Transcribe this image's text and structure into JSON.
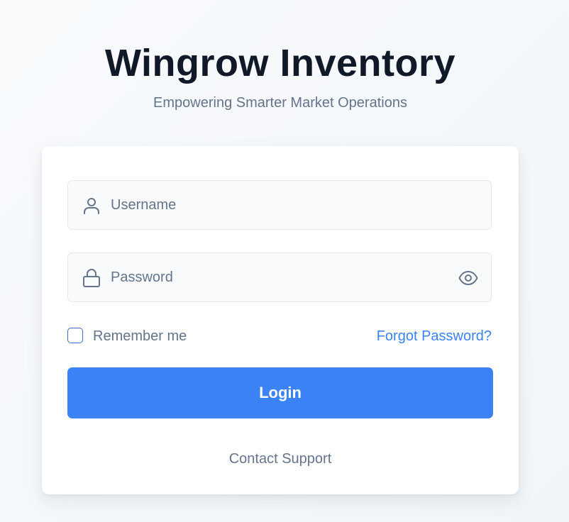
{
  "header": {
    "title": "Wingrow Inventory",
    "subtitle": "Empowering Smarter Market Operations"
  },
  "form": {
    "username": {
      "placeholder": "Username",
      "value": "",
      "icon": "user-icon"
    },
    "password": {
      "placeholder": "Password",
      "value": "",
      "icon": "lock-icon",
      "toggle_icon": "eye-icon"
    },
    "remember_label": "Remember me",
    "remember_checked": false,
    "forgot_label": "Forgot Password?",
    "login_label": "Login",
    "support_label": "Contact Support"
  },
  "colors": {
    "accent": "#3b82f6",
    "title": "#111827",
    "muted": "#64748b",
    "field_bg": "#f9fafb"
  }
}
